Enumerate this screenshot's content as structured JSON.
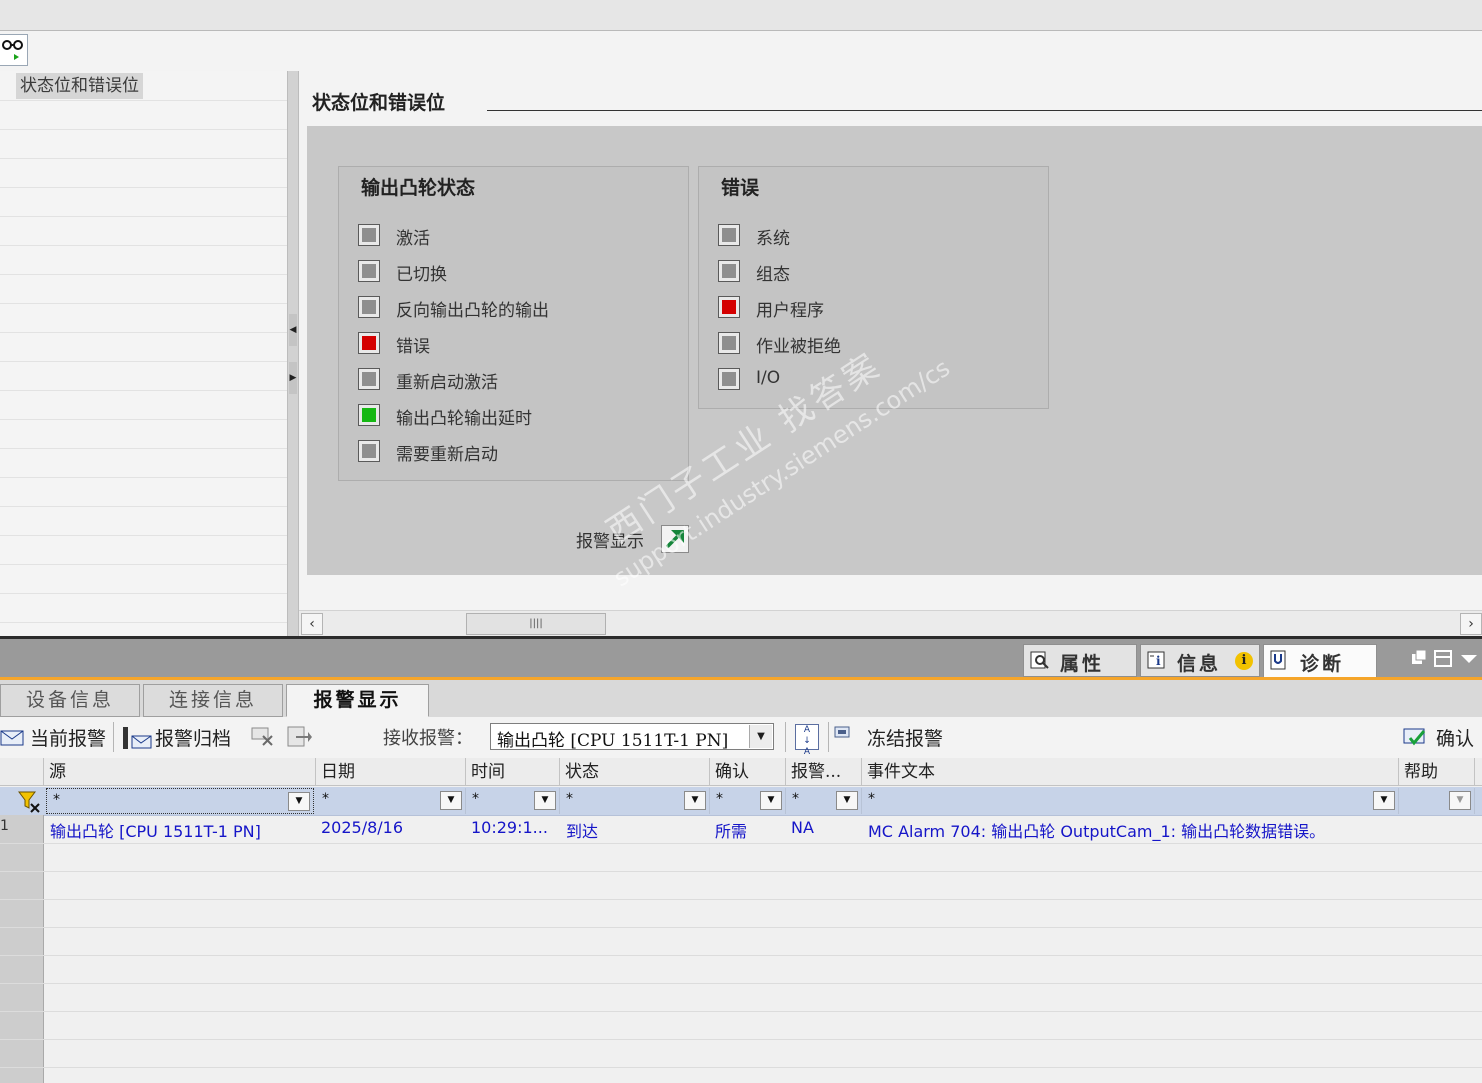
{
  "nav": {
    "selected_item": "状态位和错误位"
  },
  "section_title": "状态位和错误位",
  "groups": {
    "cam_status": {
      "title": "输出凸轮状态",
      "items": [
        {
          "label": "激活",
          "state": "gray"
        },
        {
          "label": "已切换",
          "state": "gray"
        },
        {
          "label": "反向输出凸轮的输出",
          "state": "gray"
        },
        {
          "label": "错误",
          "state": "red"
        },
        {
          "label": "重新启动激活",
          "state": "gray"
        },
        {
          "label": "输出凸轮输出延时",
          "state": "green"
        },
        {
          "label": "需要重新启动",
          "state": "gray"
        }
      ]
    },
    "errors": {
      "title": "错误",
      "items": [
        {
          "label": "系统",
          "state": "gray"
        },
        {
          "label": "组态",
          "state": "gray"
        },
        {
          "label": "用户程序",
          "state": "red"
        },
        {
          "label": "作业被拒绝",
          "state": "gray"
        },
        {
          "label": "I/O",
          "state": "gray"
        }
      ]
    }
  },
  "alarm_link_label": "报警显示",
  "inspector_tabs": {
    "properties": "属性",
    "info": "信息",
    "diagnostics": "诊断"
  },
  "sub_tabs": {
    "device_info": "设备信息",
    "connection_info": "连接信息",
    "alarm_display": "报警显示"
  },
  "alarm_toolbar": {
    "current_alarms": "当前报警",
    "alarm_archive": "报警归档",
    "receive_label": "接收报警：",
    "receive_value": "输出凸轮 [CPU 1511T-1 PN]",
    "freeze_alarms": "冻结报警",
    "acknowledge": "确认"
  },
  "table": {
    "headers": {
      "source": "源",
      "date": "日期",
      "time": "时间",
      "status": "状态",
      "ack": "确认",
      "alarm": "报警...",
      "event_text": "事件文本",
      "help": "帮助"
    },
    "filter": "*",
    "rows": [
      {
        "num": "1",
        "source": "输出凸轮 [CPU 1511T-1 PN]",
        "date": "2025/8/16",
        "time": "10:29:1...",
        "status": "到达",
        "ack": "所需",
        "alarm": "NA",
        "event_text": "MC Alarm 704: 输出凸轮 OutputCam_1: 输出凸轮数据错误。"
      }
    ]
  },
  "watermark": {
    "line1": "西门子工业 找答案",
    "line2": "support.industry.siemens.com/cs"
  },
  "colors": {
    "led_red": "#d40000",
    "led_green": "#16b814",
    "led_gray": "#8f8f8f",
    "accent_orange": "#f5a52a",
    "link_blue": "#1515c8"
  }
}
